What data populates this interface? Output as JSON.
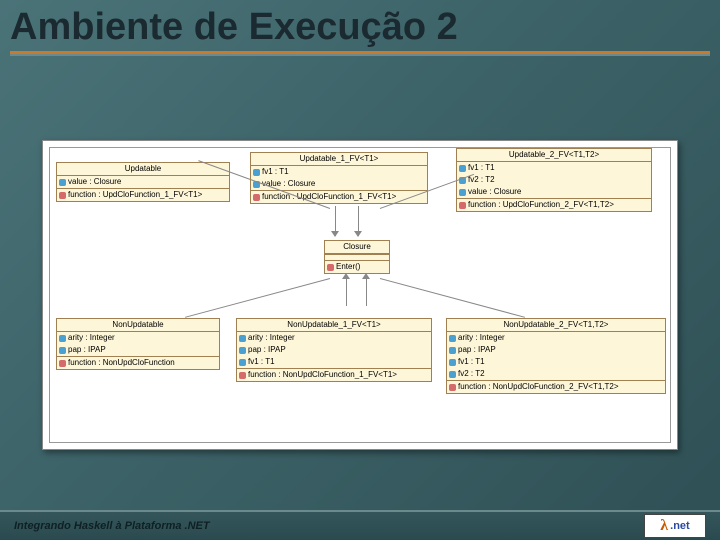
{
  "slide": {
    "title": "Ambiente de Execução 2",
    "footer": "Integrando Haskell à Plataforma .NET",
    "logo": {
      "lambda": "λ",
      "dotnet": ".net"
    }
  },
  "classes": {
    "updatable": {
      "name": "Updatable",
      "attrs": [
        "value : Closure"
      ],
      "ops": [
        "function : UpdCloFunction_1_FV<T1>"
      ]
    },
    "updatable_1": {
      "name": "Updatable_1_FV<T1>",
      "attrs": [
        "fv1 : T1",
        "value : Closure"
      ],
      "ops": [
        "function : UpdCloFunction_1_FV<T1>"
      ]
    },
    "updatable_2": {
      "name": "Updatable_2_FV<T1,T2>",
      "attrs": [
        "fv1 : T1",
        "fv2 : T2",
        "value : Closure"
      ],
      "ops": [
        "function : UpdCloFunction_2_FV<T1,T2>"
      ]
    },
    "closure": {
      "name": "Closure",
      "ops": [
        "Enter()"
      ]
    },
    "nonupdatable": {
      "name": "NonUpdatable",
      "attrs": [
        "arity : Integer",
        "pap : IPAP"
      ],
      "ops": [
        "function : NonUpdCloFunction"
      ]
    },
    "nonupdatable_1": {
      "name": "NonUpdatable_1_FV<T1>",
      "attrs": [
        "arity : Integer",
        "pap : IPAP",
        "fv1 : T1"
      ],
      "ops": [
        "function : NonUpdCloFunction_1_FV<T1>"
      ]
    },
    "nonupdatable_2": {
      "name": "NonUpdatable_2_FV<T1,T2>",
      "attrs": [
        "arity : Integer",
        "pap : IPAP",
        "fv1 : T1",
        "fv2 : T2"
      ],
      "ops": [
        "function : NonUpdCloFunction_2_FV<T1,T2>"
      ]
    }
  }
}
